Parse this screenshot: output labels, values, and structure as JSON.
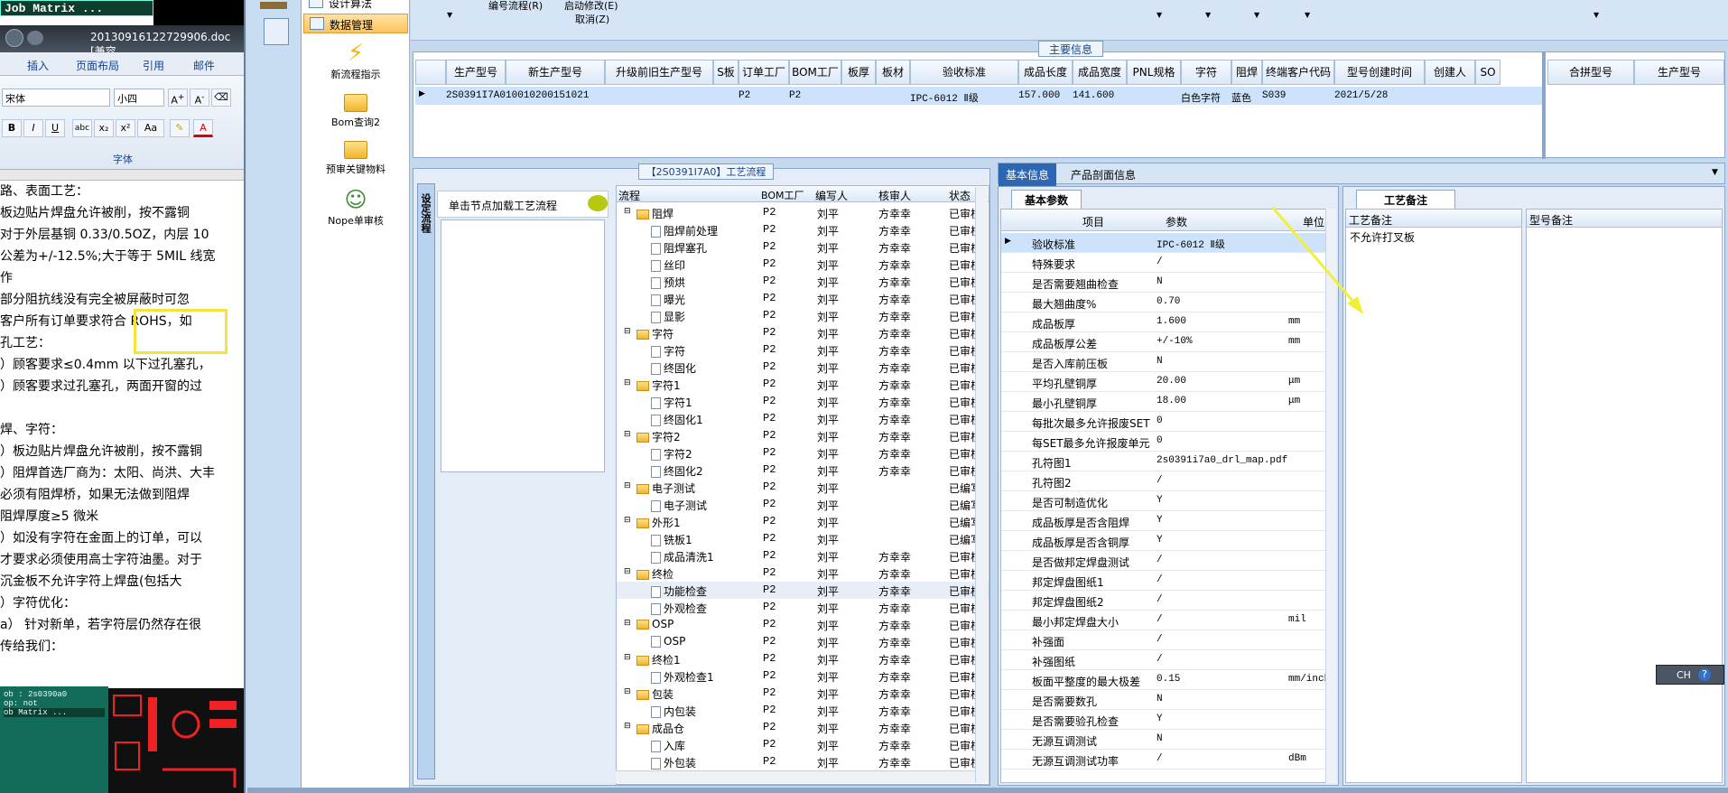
{
  "word": {
    "job_matrix": "Job Matrix ...",
    "filename": "20130916122729906.doc [兼容",
    "tabs": [
      "插入",
      "页面布局",
      "引用",
      "邮件"
    ],
    "font_name": "宋体",
    "font_size": "小四",
    "font_group": "字体",
    "lines": [
      "路、表面工艺：",
      "   板边贴片焊盘允许被削，按不露铜",
      "   对于外层基铜 0.33/0.5OZ，内层 10",
      "   公差为+/-12.5%;大于等于 5MIL 线宽",
      "   作",
      "   部分阻抗线没有完全被屏蔽时可忽",
      "   客户所有订单要求符合 ROHS，如",
      "孔工艺：",
      "）顾客要求≤0.4mm 以下过孔塞孔，",
      "）顾客要求过孔塞孔，两面开窗的过",
      "",
      "焊、字符：",
      "）板边贴片焊盘允许被削，按不露铜",
      "）阻焊首选厂商为：太阳、尚洪、大丰",
      "   必须有阻焊桥，如果无法做到阻焊",
      "   阻焊厚度≥5 微米",
      "）如没有字符在金面上的订单，可以",
      "   才要求必须使用高士字符油墨。对于",
      "   沉金板不允许字符上焊盘(包括大",
      "）字符优化：",
      "  a） 针对新单，若字符层仍然存在很",
      "       传给我们："
    ],
    "pcb_labels": [
      "ob : 2s0390a0",
      "op: not",
      "ob Matrix ..."
    ]
  },
  "nav": {
    "items": [
      "设计算法",
      "数据管理"
    ],
    "side": [
      "新流程指示",
      "Bom查询2",
      "预审关键物料",
      "Nope单审核"
    ]
  },
  "toolbar": {
    "item1": "编号流程(R)",
    "item2": "启动修改(E)",
    "cancel": "取消(Z)"
  },
  "main": {
    "caption": "主要信息",
    "headers": [
      "生产型号",
      "新生产型号",
      "升级前旧生产型号",
      "S板",
      "订单工厂",
      "BOM工厂",
      "板厚",
      "板材",
      "验收标准",
      "成品长度",
      "成品宽度",
      "PNL规格",
      "字符",
      "阻焊",
      "终端客户代码",
      "型号创建时间",
      "创建人",
      "SO"
    ],
    "row": [
      "2S0391I7A0",
      "10010200151021",
      "",
      "",
      "P2",
      "P2",
      "",
      "",
      "IPC-6012 Ⅱ级",
      "157.000",
      "141.600",
      "",
      "白色字符",
      "蓝色",
      "S039",
      "2021/5/28",
      "",
      ""
    ],
    "right_headers": [
      "合拼型号",
      "生产型号"
    ]
  },
  "process": {
    "caption": "【2S0391I7A0】工艺流程",
    "side_tab": "设定流程",
    "load_hint": "单击节点加载工艺流程",
    "headers": [
      "流程",
      "BOM工厂",
      "编写人",
      "核审人",
      "状态"
    ],
    "rows": [
      {
        "name": "阻焊",
        "lvl": 0,
        "f": "P2",
        "w": "刘平",
        "c": "方幸幸",
        "s": "已审核"
      },
      {
        "name": "阻焊前处理",
        "lvl": 1,
        "f": "P2",
        "w": "刘平",
        "c": "方幸幸",
        "s": "已审核"
      },
      {
        "name": "阻焊塞孔",
        "lvl": 1,
        "f": "P2",
        "w": "刘平",
        "c": "方幸幸",
        "s": "已审核"
      },
      {
        "name": "丝印",
        "lvl": 1,
        "f": "P2",
        "w": "刘平",
        "c": "方幸幸",
        "s": "已审核"
      },
      {
        "name": "预烘",
        "lvl": 1,
        "f": "P2",
        "w": "刘平",
        "c": "方幸幸",
        "s": "已审核"
      },
      {
        "name": "曝光",
        "lvl": 1,
        "f": "P2",
        "w": "刘平",
        "c": "方幸幸",
        "s": "已审核"
      },
      {
        "name": "显影",
        "lvl": 1,
        "f": "P2",
        "w": "刘平",
        "c": "方幸幸",
        "s": "已审核"
      },
      {
        "name": "字符",
        "lvl": 0,
        "f": "P2",
        "w": "刘平",
        "c": "方幸幸",
        "s": "已审核"
      },
      {
        "name": "字符",
        "lvl": 1,
        "f": "P2",
        "w": "刘平",
        "c": "方幸幸",
        "s": "已审核"
      },
      {
        "name": "终固化",
        "lvl": 1,
        "f": "P2",
        "w": "刘平",
        "c": "方幸幸",
        "s": "已审核"
      },
      {
        "name": "字符1",
        "lvl": 0,
        "f": "P2",
        "w": "刘平",
        "c": "方幸幸",
        "s": "已审核"
      },
      {
        "name": "字符1",
        "lvl": 1,
        "f": "P2",
        "w": "刘平",
        "c": "方幸幸",
        "s": "已审核"
      },
      {
        "name": "终固化1",
        "lvl": 1,
        "f": "P2",
        "w": "刘平",
        "c": "方幸幸",
        "s": "已审核"
      },
      {
        "name": "字符2",
        "lvl": 0,
        "f": "P2",
        "w": "刘平",
        "c": "方幸幸",
        "s": "已审核"
      },
      {
        "name": "字符2",
        "lvl": 1,
        "f": "P2",
        "w": "刘平",
        "c": "方幸幸",
        "s": "已审核"
      },
      {
        "name": "终固化2",
        "lvl": 1,
        "f": "P2",
        "w": "刘平",
        "c": "方幸幸",
        "s": "已审核"
      },
      {
        "name": "电子测试",
        "lvl": 0,
        "f": "P2",
        "w": "刘平",
        "c": "",
        "s": "已编写"
      },
      {
        "name": "电子测试",
        "lvl": 1,
        "f": "P2",
        "w": "刘平",
        "c": "",
        "s": "已编写"
      },
      {
        "name": "外形1",
        "lvl": 0,
        "f": "P2",
        "w": "刘平",
        "c": "",
        "s": "已编写"
      },
      {
        "name": "铣板1",
        "lvl": 1,
        "f": "P2",
        "w": "刘平",
        "c": "",
        "s": "已编写"
      },
      {
        "name": "成品清洗1",
        "lvl": 1,
        "f": "P2",
        "w": "刘平",
        "c": "方幸幸",
        "s": "已审核"
      },
      {
        "name": "终检",
        "lvl": 0,
        "f": "P2",
        "w": "刘平",
        "c": "方幸幸",
        "s": "已审核"
      },
      {
        "name": "功能检查",
        "lvl": 1,
        "f": "P2",
        "w": "刘平",
        "c": "方幸幸",
        "s": "已审核"
      },
      {
        "name": "外观检查",
        "lvl": 1,
        "f": "P2",
        "w": "刘平",
        "c": "方幸幸",
        "s": "已审核"
      },
      {
        "name": "OSP",
        "lvl": 0,
        "f": "P2",
        "w": "刘平",
        "c": "方幸幸",
        "s": "已审核"
      },
      {
        "name": "OSP",
        "lvl": 1,
        "f": "P2",
        "w": "刘平",
        "c": "方幸幸",
        "s": "已审核"
      },
      {
        "name": "终检1",
        "lvl": 0,
        "f": "P2",
        "w": "刘平",
        "c": "方幸幸",
        "s": "已审核"
      },
      {
        "name": "外观检查1",
        "lvl": 1,
        "f": "P2",
        "w": "刘平",
        "c": "方幸幸",
        "s": "已审核"
      },
      {
        "name": "包装",
        "lvl": 0,
        "f": "P2",
        "w": "刘平",
        "c": "方幸幸",
        "s": "已审核"
      },
      {
        "name": "内包装",
        "lvl": 1,
        "f": "P2",
        "w": "刘平",
        "c": "方幸幸",
        "s": "已审核"
      },
      {
        "name": "成品仓",
        "lvl": 0,
        "f": "P2",
        "w": "刘平",
        "c": "方幸幸",
        "s": "已审核"
      },
      {
        "name": "入库",
        "lvl": 1,
        "f": "P2",
        "w": "刘平",
        "c": "方幸幸",
        "s": "已审核"
      },
      {
        "name": "外包装",
        "lvl": 1,
        "f": "P2",
        "w": "刘平",
        "c": "方幸幸",
        "s": "已审核"
      }
    ]
  },
  "info": {
    "tab_basic": "基本信息",
    "tab_section": "产品剖面信息",
    "subtab": "基本参数",
    "headers": [
      "项目",
      "参数",
      "单位"
    ],
    "rows": [
      {
        "k": "验收标准",
        "v": "IPC-6012 Ⅱ级",
        "u": ""
      },
      {
        "k": "特殊要求",
        "v": "/",
        "u": ""
      },
      {
        "k": "是否需要翘曲检查",
        "v": "N",
        "u": ""
      },
      {
        "k": "最大翘曲度%",
        "v": "0.70",
        "u": ""
      },
      {
        "k": "成品板厚",
        "v": "1.600",
        "u": "mm"
      },
      {
        "k": "成品板厚公差",
        "v": "+/-10%",
        "u": "mm"
      },
      {
        "k": "是否入库前压板",
        "v": "N",
        "u": ""
      },
      {
        "k": "平均孔壁铜厚",
        "v": "20.00",
        "u": "μm"
      },
      {
        "k": "最小孔壁铜厚",
        "v": "18.00",
        "u": "μm"
      },
      {
        "k": "每批次最多允许报废SET",
        "v": "0",
        "u": ""
      },
      {
        "k": "每SET最多允许报废单元",
        "v": "0",
        "u": ""
      },
      {
        "k": "孔符图1",
        "v": "2s0391i7a0_drl_map.pdf",
        "u": ""
      },
      {
        "k": "孔符图2",
        "v": "/",
        "u": ""
      },
      {
        "k": "是否可制造优化",
        "v": "Y",
        "u": ""
      },
      {
        "k": "成品板厚是否含阻焊",
        "v": "Y",
        "u": ""
      },
      {
        "k": "成品板厚是否含铜厚",
        "v": "Y",
        "u": ""
      },
      {
        "k": "是否做邦定焊盘测试",
        "v": "/",
        "u": ""
      },
      {
        "k": "邦定焊盘图纸1",
        "v": "/",
        "u": ""
      },
      {
        "k": "邦定焊盘图纸2",
        "v": "/",
        "u": ""
      },
      {
        "k": "最小邦定焊盘大小",
        "v": "/",
        "u": "mil"
      },
      {
        "k": "补强面",
        "v": "/",
        "u": ""
      },
      {
        "k": "补强图纸",
        "v": "/",
        "u": ""
      },
      {
        "k": "板面平整度的最大极差",
        "v": "0.15",
        "u": "mm/inch"
      },
      {
        "k": "是否需要数孔",
        "v": "N",
        "u": ""
      },
      {
        "k": "是否需要验孔检查",
        "v": "Y",
        "u": ""
      },
      {
        "k": "无源互调测试",
        "v": "N",
        "u": ""
      },
      {
        "k": "无源互调测试功率",
        "v": "/",
        "u": "dBm"
      }
    ]
  },
  "remarks": {
    "tab": "工艺备注",
    "col1": "工艺备注",
    "col2": "型号备注",
    "text": "不允许打叉板"
  },
  "lang": {
    "label": "CH"
  }
}
